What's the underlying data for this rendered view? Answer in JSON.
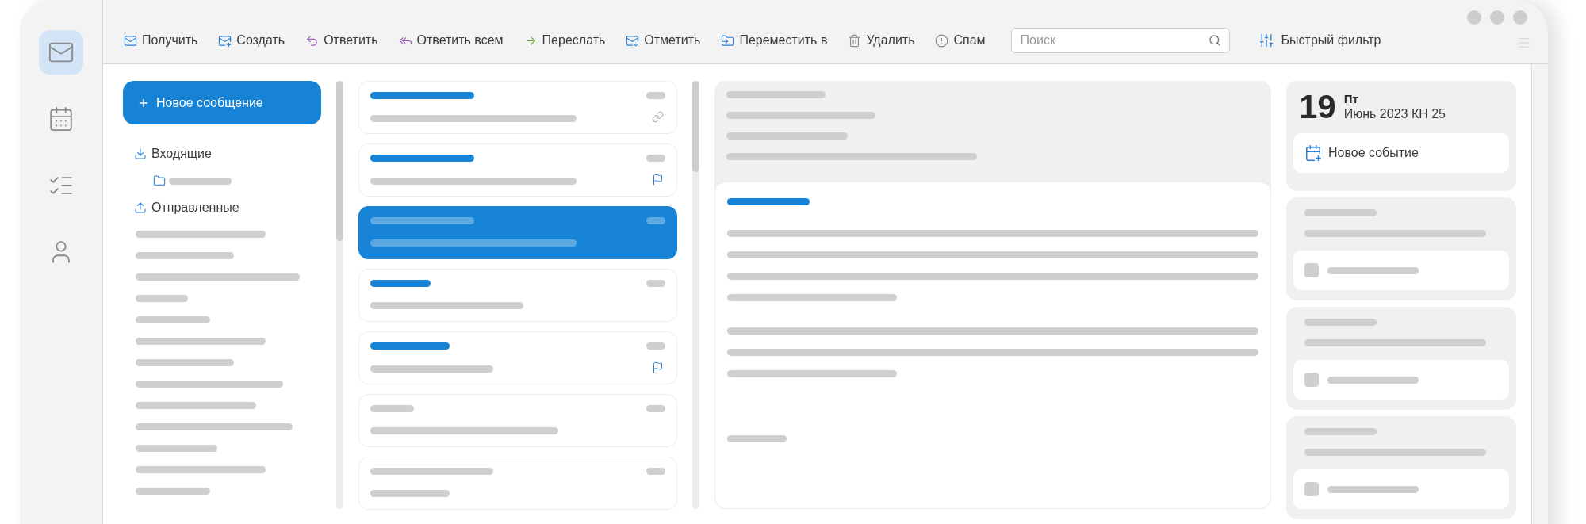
{
  "rail": [
    {
      "kind": "mail",
      "selected": true
    },
    {
      "kind": "calendar",
      "selected": false
    },
    {
      "kind": "tasks",
      "selected": false
    },
    {
      "kind": "contacts",
      "selected": false
    }
  ],
  "toolbar": {
    "buttons": [
      {
        "label": "Получить",
        "kind": "get"
      },
      {
        "label": "Создать",
        "kind": "compose"
      },
      {
        "label": "Ответить",
        "kind": "reply"
      },
      {
        "label": "Ответить всем",
        "kind": "reply_all"
      },
      {
        "label": "Переслать",
        "kind": "forward"
      },
      {
        "label": "Отметить",
        "kind": "mark"
      },
      {
        "label": "Переместить в",
        "kind": "move"
      },
      {
        "label": "Удалить",
        "kind": "delete"
      },
      {
        "label": "Спам",
        "kind": "spam"
      }
    ],
    "search": {
      "placeholder": "Поиск"
    },
    "quick_filter": "Быстрый фильтр"
  },
  "new_message_button": "Новое сообщение",
  "folders": [
    {
      "label": "Входящие",
      "kind": "inbox",
      "children": [
        {
          "kind": "folder"
        }
      ]
    },
    {
      "label": "Отправленные",
      "kind": "sent"
    }
  ],
  "messages": [
    {
      "selected": false,
      "unread": true,
      "has_link": true,
      "flagged": false
    },
    {
      "selected": false,
      "unread": true,
      "has_link": false,
      "flagged": true
    },
    {
      "selected": true,
      "unread": true,
      "has_link": false,
      "flagged": false
    },
    {
      "selected": false,
      "unread": true,
      "has_link": false,
      "flagged": false
    },
    {
      "selected": false,
      "unread": true,
      "has_link": false,
      "flagged": true
    },
    {
      "selected": false,
      "unread": false,
      "has_link": false,
      "flagged": false
    },
    {
      "selected": false,
      "unread": false,
      "has_link": false,
      "flagged": false
    }
  ],
  "calendar": {
    "day": "19",
    "weekday": "Пт",
    "month_line": "Июнь 2023 КН 25",
    "new_event_button": "Новое событие"
  },
  "tasks": [
    {
      "checked": false
    },
    {
      "checked": false
    },
    {
      "checked": false
    }
  ]
}
